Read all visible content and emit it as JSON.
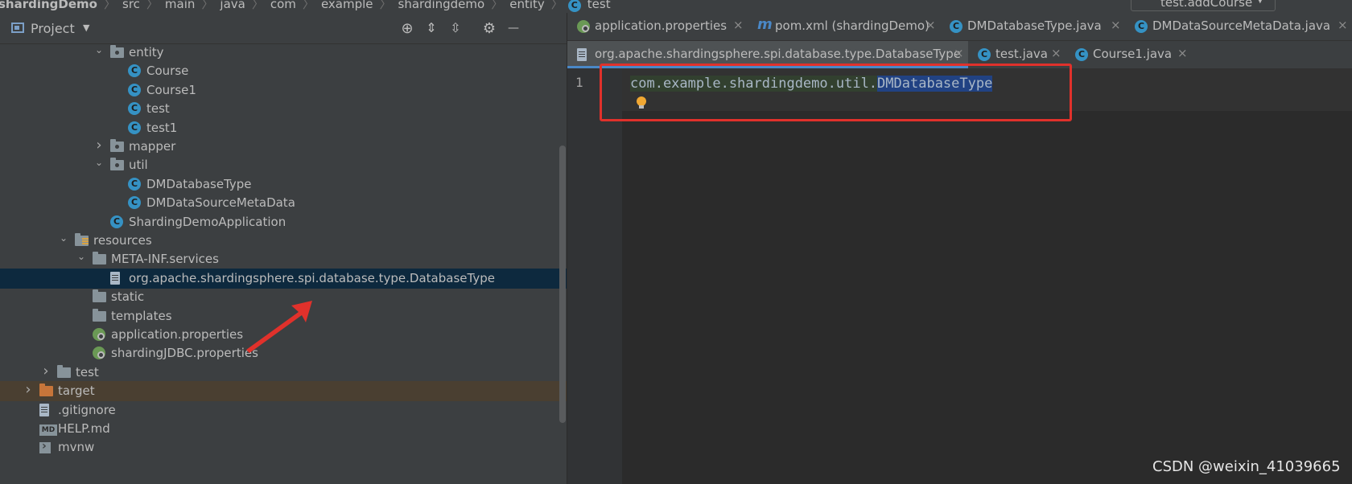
{
  "breadcrumb": {
    "items": [
      "shardingDemo",
      "src",
      "main",
      "java",
      "com",
      "example",
      "shardingdemo",
      "entity",
      "test"
    ]
  },
  "run_config": {
    "label": "test.addCourse"
  },
  "project_panel": {
    "title": "Project",
    "tree": [
      {
        "label": "entity",
        "type": "package",
        "level": 5,
        "expanded": true
      },
      {
        "label": "Course",
        "type": "class",
        "level": 6
      },
      {
        "label": "Course1",
        "type": "class",
        "level": 6
      },
      {
        "label": "test",
        "type": "class",
        "level": 6
      },
      {
        "label": "test1",
        "type": "class",
        "level": 6
      },
      {
        "label": "mapper",
        "type": "package",
        "level": 5,
        "expanded": false
      },
      {
        "label": "util",
        "type": "package",
        "level": 5,
        "expanded": true
      },
      {
        "label": "DMDatabaseType",
        "type": "class",
        "level": 6
      },
      {
        "label": "DMDataSourceMetaData",
        "type": "class",
        "level": 6
      },
      {
        "label": "ShardingDemoApplication",
        "type": "app-class",
        "level": 5
      },
      {
        "label": "resources",
        "type": "resources-folder",
        "level": 3,
        "expanded": true
      },
      {
        "label": "META-INF.services",
        "type": "folder",
        "level": 4,
        "expanded": true
      },
      {
        "label": "org.apache.shardingsphere.spi.database.type.DatabaseType",
        "type": "file",
        "level": 5,
        "selected": true
      },
      {
        "label": "static",
        "type": "folder",
        "level": 4
      },
      {
        "label": "templates",
        "type": "folder",
        "level": 4
      },
      {
        "label": "application.properties",
        "type": "properties",
        "level": 4
      },
      {
        "label": "shardingJDBC.properties",
        "type": "properties",
        "level": 4
      },
      {
        "label": "test",
        "type": "folder",
        "level": 2,
        "expanded": false
      },
      {
        "label": "target",
        "type": "target-folder",
        "level": 1,
        "expanded": false
      },
      {
        "label": ".gitignore",
        "type": "file",
        "level": 1
      },
      {
        "label": "HELP.md",
        "type": "md",
        "level": 1
      },
      {
        "label": "mvnw",
        "type": "terminal",
        "level": 1
      }
    ]
  },
  "editor": {
    "tabs_row1": [
      {
        "label": "application.properties",
        "icon": "properties"
      },
      {
        "label": "pom.xml (shardingDemo)",
        "icon": "maven"
      },
      {
        "label": "DMDatabaseType.java",
        "icon": "class"
      },
      {
        "label": "DMDataSourceMetaData.java",
        "icon": "class"
      }
    ],
    "tabs_row2": [
      {
        "label": "org.apache.shardingsphere.spi.database.type.DatabaseType",
        "icon": "file",
        "active": true
      },
      {
        "label": "test.java",
        "icon": "class"
      },
      {
        "label": "Course1.java",
        "icon": "class"
      }
    ],
    "line_number": "1",
    "code_prefix": "com.example.shardingdemo.util.",
    "code_highlight": "DMDatabaseType"
  },
  "icons": {
    "class_glyph": "C",
    "md_glyph": "MD",
    "close_glyph": "×",
    "gear_glyph": "⚙",
    "target_glyph": "⊕",
    "minimize_glyph": "—"
  },
  "watermark": "CSDN @weixin_41039665",
  "colors": {
    "selection": "#0d293e",
    "highlight": "#214283",
    "annotation": "#e0312b",
    "class_icon": "#3592c4"
  }
}
